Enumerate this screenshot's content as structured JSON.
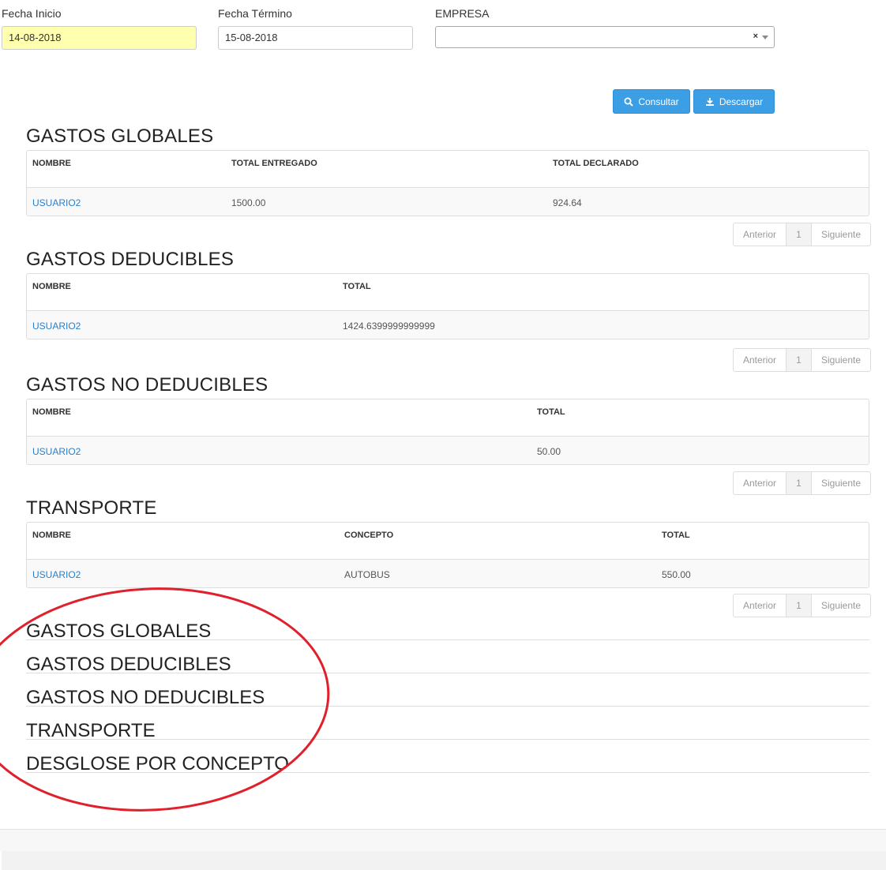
{
  "filters": {
    "fecha_inicio": {
      "label": "Fecha Inicio",
      "value": "14-08-2018"
    },
    "fecha_termino": {
      "label": "Fecha Término",
      "value": "15-08-2018"
    },
    "empresa": {
      "label": "EMPRESA",
      "value": "",
      "clear": "×"
    }
  },
  "buttons": {
    "consultar": "Consultar",
    "descargar": "Descargar"
  },
  "tables": {
    "globales": {
      "title": "GASTOS GLOBALES",
      "headers": [
        "NOMBRE",
        "TOTAL ENTREGADO",
        "TOTAL DECLARADO"
      ],
      "rows": [
        [
          "USUARIO2",
          "1500.00",
          "924.64"
        ]
      ]
    },
    "deducibles": {
      "title": "GASTOS DEDUCIBLES",
      "headers": [
        "NOMBRE",
        "TOTAL"
      ],
      "rows": [
        [
          "USUARIO2",
          "1424.6399999999999"
        ]
      ]
    },
    "no_deducibles": {
      "title": "GASTOS NO DEDUCIBLES",
      "headers": [
        "NOMBRE",
        "TOTAL"
      ],
      "rows": [
        [
          "USUARIO2",
          "50.00"
        ]
      ]
    },
    "transporte": {
      "title": "TRANSPORTE",
      "headers": [
        "NOMBRE",
        "CONCEPTO",
        "TOTAL"
      ],
      "rows": [
        [
          "USUARIO2",
          "AUTOBUS",
          "550.00"
        ]
      ]
    }
  },
  "pager": {
    "prev": "Anterior",
    "page": "1",
    "next": "Siguiente"
  },
  "collapsed_sections": [
    "GASTOS GLOBALES",
    "GASTOS DEDUCIBLES",
    "GASTOS NO DEDUCIBLES",
    "TRANSPORTE",
    "DESGLOSE POR CONCEPTO"
  ],
  "colors": {
    "primary_button": "#3c9ee5",
    "link": "#2a7fc9",
    "highlight_input": "#ffffb0",
    "annotation": "#e0202a"
  }
}
